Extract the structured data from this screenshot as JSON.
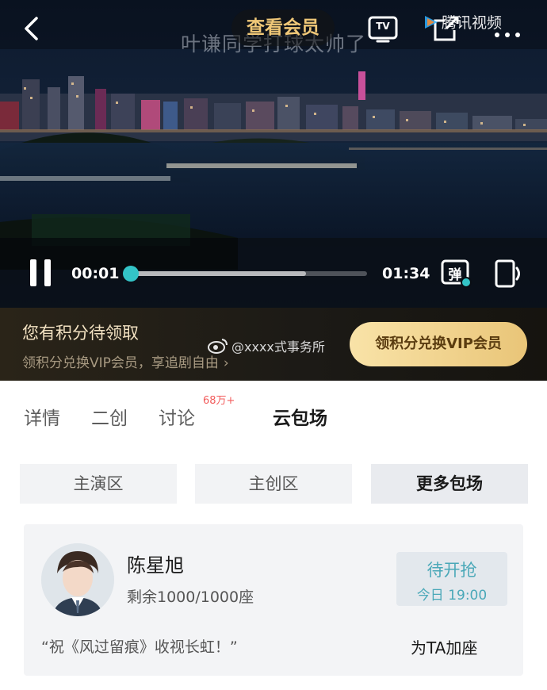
{
  "header": {
    "vip_label": "查看会员",
    "app_watermark": "腾讯视频",
    "tv_icon_text": "TV"
  },
  "video": {
    "subtitle": "叶谦同学打球太帅了",
    "current_time": "00:01",
    "total_time": "01:34",
    "progress_fraction": 0.0,
    "buffered_fraction": 0.74,
    "danmu_label": "弹",
    "accent_color": "#33c4c7"
  },
  "banner": {
    "title": "您有积分待领取",
    "subtitle": "领积分兑换VIP会员，享追剧自由",
    "arrow": "›",
    "cta": "领积分兑换VIP会员",
    "weibo_watermark": "@xxxx式事务所"
  },
  "tabs": {
    "items": [
      {
        "label": "详情"
      },
      {
        "label": "二创"
      },
      {
        "label": "讨论"
      },
      {
        "label": "云包场"
      }
    ],
    "discussion_badge": "68万+",
    "active_index": 3
  },
  "segments": {
    "items": [
      {
        "label": "主演区"
      },
      {
        "label": "主创区"
      },
      {
        "label": "更多包场"
      }
    ],
    "active_index": 2
  },
  "card": {
    "name": "陈星旭",
    "seats": "剩余1000/1000座",
    "status": "待开抢",
    "status_time": "今日 19:00",
    "quote": "“祝《风过留痕》收视长虹！”",
    "add_seat": "为TA加座",
    "status_color": "#4aa8b8"
  }
}
